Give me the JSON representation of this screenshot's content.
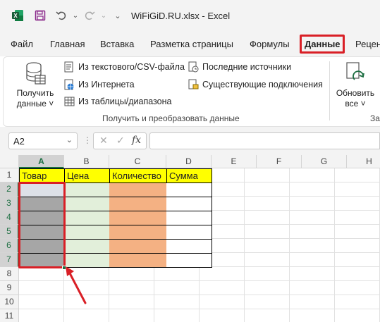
{
  "titlebar": {
    "title": "WiFiGiD.RU.xlsx  -  Excel",
    "save_icon": "save-icon",
    "undo_icon": "undo-icon",
    "redo_icon": "redo-icon"
  },
  "menu": {
    "tabs": [
      {
        "label": "Файл"
      },
      {
        "label": "Главная"
      },
      {
        "label": "Вставка"
      },
      {
        "label": "Разметка страницы"
      },
      {
        "label": "Формулы"
      },
      {
        "label": "Данные"
      },
      {
        "label": "Рецен"
      }
    ],
    "active_tab": "Данные",
    "highlight_color": "#d91f26"
  },
  "ribbon": {
    "get_data": {
      "line1": "Получить",
      "line2": "данные ˅"
    },
    "commands": [
      {
        "label": "Из текстового/CSV-файла",
        "icon": "text-file-icon"
      },
      {
        "label": "Из Интернета",
        "icon": "globe-icon"
      },
      {
        "label": "Из таблицы/диапазона",
        "icon": "table-icon"
      },
      {
        "label": "Последние источники",
        "icon": "recent-sources-icon"
      },
      {
        "label": "Существующие подключения",
        "icon": "connections-icon"
      }
    ],
    "group_label": "Получить и преобразовать данные",
    "refresh": {
      "line1": "Обновить",
      "line2": "все ˅"
    },
    "group_label2": "За"
  },
  "formula_bar": {
    "name_box": "A2",
    "fx": "fx",
    "formula": ""
  },
  "grid": {
    "columns": [
      "A",
      "B",
      "C",
      "D",
      "E",
      "F",
      "G",
      "H"
    ],
    "rows": [
      "1",
      "2",
      "3",
      "4",
      "5",
      "6",
      "7",
      "8",
      "9",
      "10",
      "11"
    ],
    "headers": [
      "Товар",
      "Цена",
      "Количество",
      "Сумма"
    ],
    "selected_range": "A2:A7",
    "colors": {
      "header": "#ffff00",
      "price": "#e2efda",
      "quantity": "#f4b183",
      "selection": "#a6a6a6",
      "accent": "#1d6f42",
      "annotation": "#d91f26"
    }
  }
}
